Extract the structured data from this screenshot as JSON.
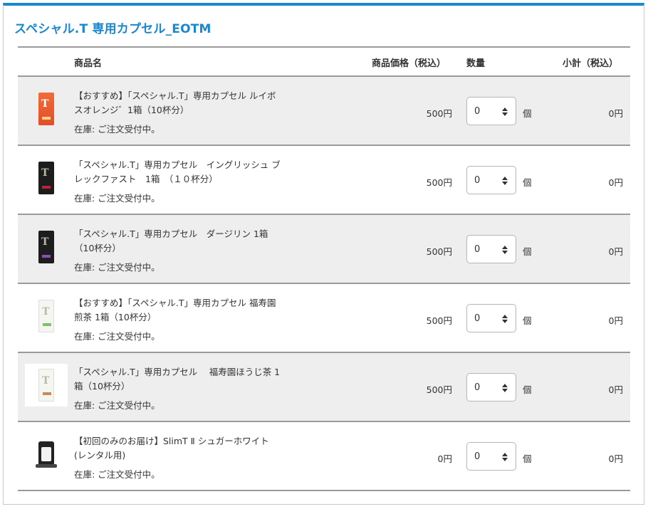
{
  "title": "スペシャル.T 専用カプセル_EOTM",
  "headers": {
    "name": "商品名",
    "price": "商品価格（税込）",
    "qty": "数量",
    "subtotal": "小計（税込）"
  },
  "unit_label": "個",
  "products": [
    {
      "name": "【おすすめ】「スペシャル.T」専用カプセル ルイボスオレンジ゛1箱（10杯分）",
      "stock": "在庫: ご注文受付中。",
      "price": "500円",
      "qty": "0",
      "subtotal": "0円",
      "icon": "orange-tea-capsule-box-icon"
    },
    {
      "name": "「スペシャル.T」専用カプセル　イングリッシュ ブレックファスト　1箱　（１０杯分）",
      "stock": "在庫: ご注文受付中。",
      "price": "500円",
      "qty": "0",
      "subtotal": "0円",
      "icon": "black-tea-capsule-box-icon"
    },
    {
      "name": "「スペシャル.T」専用カプセル　ダージリン 1箱（10杯分）",
      "stock": "在庫: ご注文受付中。",
      "price": "500円",
      "qty": "0",
      "subtotal": "0円",
      "icon": "black-tea-capsule-box-icon"
    },
    {
      "name": "【おすすめ】「スペシャル.T」専用カプセル 福寿園煎茶 1箱（10杯分）",
      "stock": "在庫: ご注文受付中。",
      "price": "500円",
      "qty": "0",
      "subtotal": "0円",
      "icon": "white-tea-capsule-box-icon"
    },
    {
      "name": "「スペシャル.T」専用カプセル　 福寿園ほうじ茶 1箱（10杯分）",
      "stock": "在庫: ご注文受付中。",
      "price": "500円",
      "qty": "0",
      "subtotal": "0円",
      "icon": "white-tea-capsule-box-icon"
    },
    {
      "name": "【初回のみのお届け】SlimT Ⅱ シュガーホワイト(レンタル用)",
      "stock": "在庫: ご注文受付中。",
      "price": "0円",
      "qty": "0",
      "subtotal": "0円",
      "icon": "tea-machine-icon"
    }
  ]
}
